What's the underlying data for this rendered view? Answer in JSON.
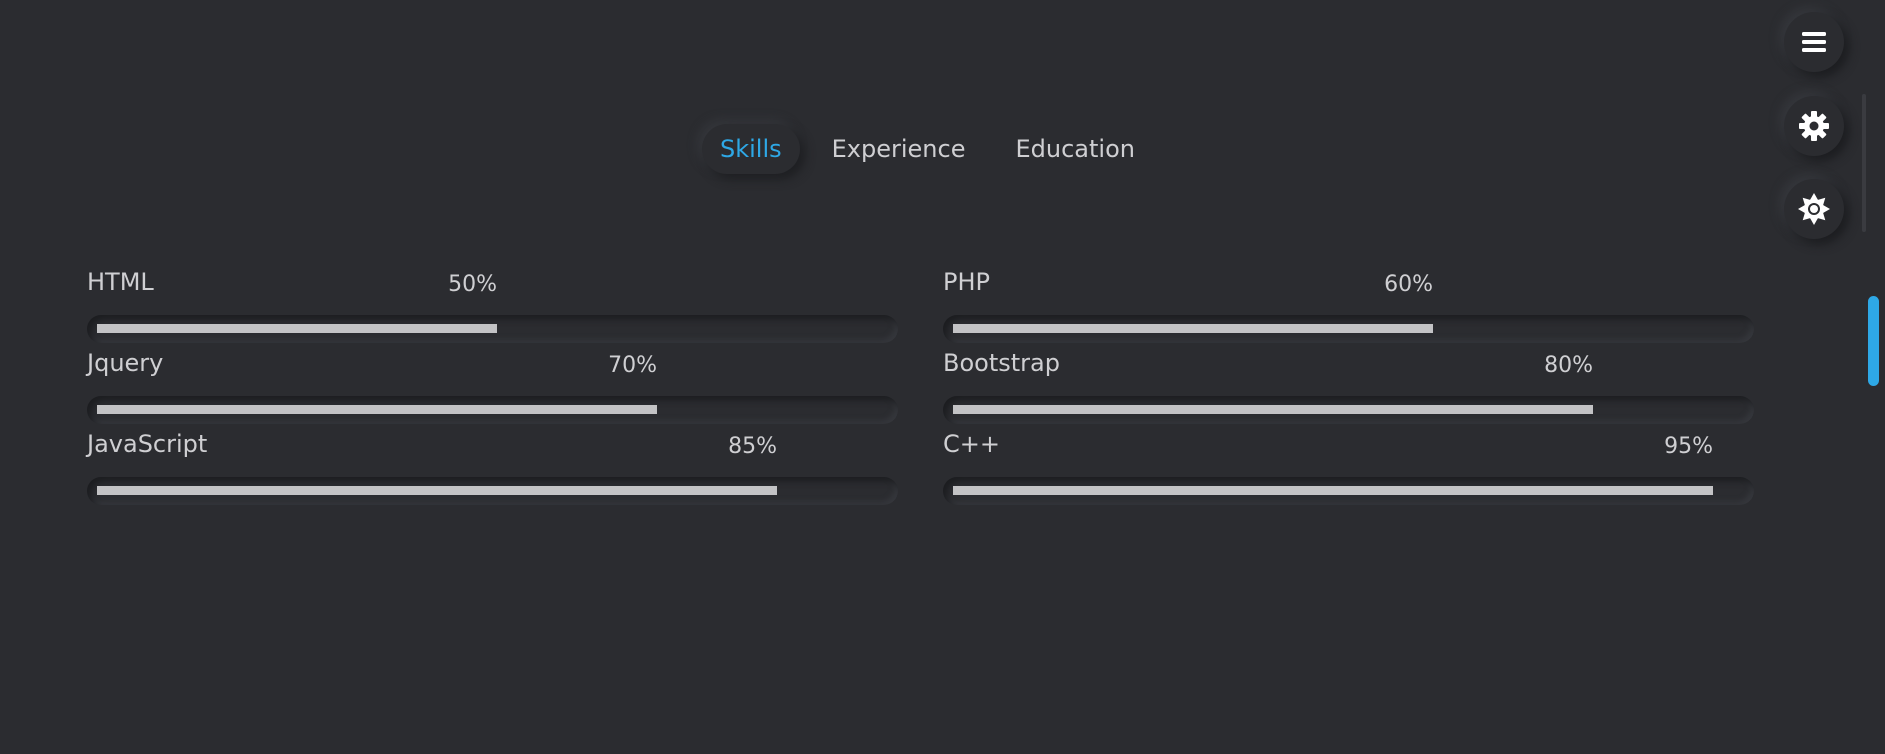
{
  "tabs": [
    {
      "label": "Skills",
      "active": true
    },
    {
      "label": "Experience",
      "active": false
    },
    {
      "label": "Education",
      "active": false
    }
  ],
  "floating_buttons": [
    {
      "icon": "menu-icon"
    },
    {
      "icon": "gear-icon"
    },
    {
      "icon": "brightness-icon"
    }
  ],
  "accent_color": "#2ea8e6",
  "skills": [
    {
      "name": "HTML",
      "percent_label": "50%",
      "level": 0.5
    },
    {
      "name": "PHP",
      "percent_label": "60%",
      "level": 0.6
    },
    {
      "name": "Jquery",
      "percent_label": "70%",
      "level": 0.7
    },
    {
      "name": "Bootstrap",
      "percent_label": "80%",
      "level": 0.8
    },
    {
      "name": "JavaScript",
      "percent_label": "85%",
      "level": 0.85
    },
    {
      "name": "C++",
      "percent_label": "95%",
      "level": 0.95
    }
  ]
}
